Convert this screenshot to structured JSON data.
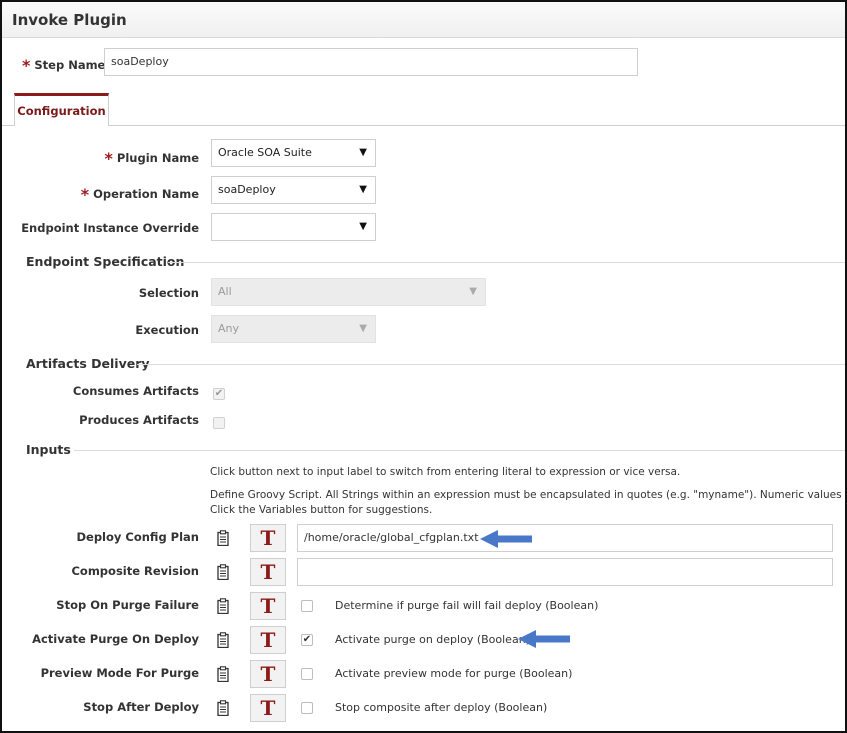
{
  "window": {
    "title": "Invoke Plugin"
  },
  "step": {
    "label": "Step Name",
    "value": "soaDeploy"
  },
  "tabs": [
    {
      "label": "Configuration"
    }
  ],
  "config": {
    "plugin_name": {
      "label": "Plugin Name",
      "value": "Oracle SOA Suite"
    },
    "operation_name": {
      "label": "Operation Name",
      "value": "soaDeploy"
    },
    "endpoint_override": {
      "label": "Endpoint Instance Override",
      "value": ""
    }
  },
  "endpoint_spec": {
    "title": "Endpoint Specification",
    "selection": {
      "label": "Selection",
      "value": "All"
    },
    "execution": {
      "label": "Execution",
      "value": "Any"
    }
  },
  "artifacts": {
    "title": "Artifacts Delivery",
    "consumes": {
      "label": "Consumes Artifacts",
      "checked": true
    },
    "produces": {
      "label": "Produces Artifacts",
      "checked": false
    }
  },
  "inputs": {
    "title": "Inputs",
    "info_line1": "Click button next to input label to switch from entering literal to expression or vice versa.",
    "info_line2": "Define Groovy Script. All Strings within an expression must be encapsulated in quotes (e.g. \"myname\"). Numeric values must not u",
    "info_line3": "Click the Variables button for suggestions.",
    "toggle_label": "T",
    "rows": [
      {
        "label": "Deploy Config Plan",
        "value": "/home/oracle/global_cfgplan.txt"
      },
      {
        "label": "Composite Revision",
        "value": ""
      },
      {
        "label": "Stop On Purge Failure",
        "desc": "Determine if purge fail will fail deploy (Boolean)",
        "checked": false
      },
      {
        "label": "Activate Purge On Deploy",
        "desc": "Activate purge on deploy (Boolean)",
        "checked": true
      },
      {
        "label": "Preview Mode For Purge",
        "desc": "Activate preview mode for purge (Boolean)",
        "checked": false
      },
      {
        "label": "Stop After Deploy",
        "desc": "Stop composite after deploy (Boolean)",
        "checked": false
      }
    ]
  },
  "icons": {
    "required": "*",
    "dropdown": "▼",
    "check": "✔",
    "clipboard": "clipboard-icon",
    "annotation_arrow": "arrow-left-icon"
  },
  "colors": {
    "accent": "#8b1a1a",
    "annotation": "#4a78c8"
  }
}
